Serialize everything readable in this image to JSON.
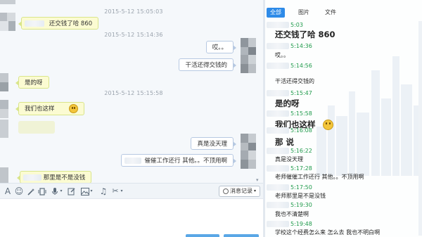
{
  "chat": {
    "timestamps": [
      "2015-5-12 15:05:03",
      "2015-5-12 15:14:36",
      "2015-5-12 15:15:58"
    ],
    "messages": [
      {
        "dir": "in",
        "text": "还交钱了哈 860"
      },
      {
        "dir": "out",
        "text": "哎。。"
      },
      {
        "dir": "out",
        "text": "干活还得交钱的"
      },
      {
        "dir": "in",
        "text": "是的呀"
      },
      {
        "dir": "in",
        "text": "我们也这样"
      },
      {
        "dir": "out",
        "text": "真是没天理"
      },
      {
        "dir": "out",
        "text": "催催工作还行  其他。。不顶用啊"
      },
      {
        "dir": "in",
        "text": "那里是不是没钱"
      }
    ]
  },
  "toolbar": {
    "font_icon": "A",
    "emoji_icon": "☺",
    "history_label": "消息记录"
  },
  "history": {
    "tabs": [
      "全部",
      "图片",
      "文件"
    ],
    "entries": [
      {
        "time": "5:03"
      },
      {
        "text": "还交钱了哈 860",
        "big": true
      },
      {
        "time": "5:14:36"
      },
      {
        "text": "哎。。"
      },
      {
        "time": "5:14:56"
      },
      {
        "text": "干活还得交钱的"
      },
      {
        "time": "5:15:47"
      },
      {
        "text": "是的呀",
        "big": true
      },
      {
        "time": "5:15:58"
      },
      {
        "text": "我们也这样",
        "big": true
      },
      {
        "time": "5:16:08"
      },
      {
        "text": "那      说",
        "big": true
      },
      {
        "time": "5:16:22"
      },
      {
        "text": "真是没天理"
      },
      {
        "time": "5:17:28"
      },
      {
        "text": "老师催催工作还行  其他。。不顶用啊"
      },
      {
        "time": "5:17:50"
      },
      {
        "text": "老师那里是不是没钱"
      },
      {
        "time": "5:19:30"
      },
      {
        "text": "我也不清楚啊"
      },
      {
        "time": "5:19:48"
      },
      {
        "text": "学校这个经费怎么来  怎么去  我也不明白啊"
      }
    ]
  },
  "colors": {
    "accent": "#2e8be8",
    "incoming_bubble": "#fbfbd2",
    "timestamp_green": "#1f9a4b"
  }
}
